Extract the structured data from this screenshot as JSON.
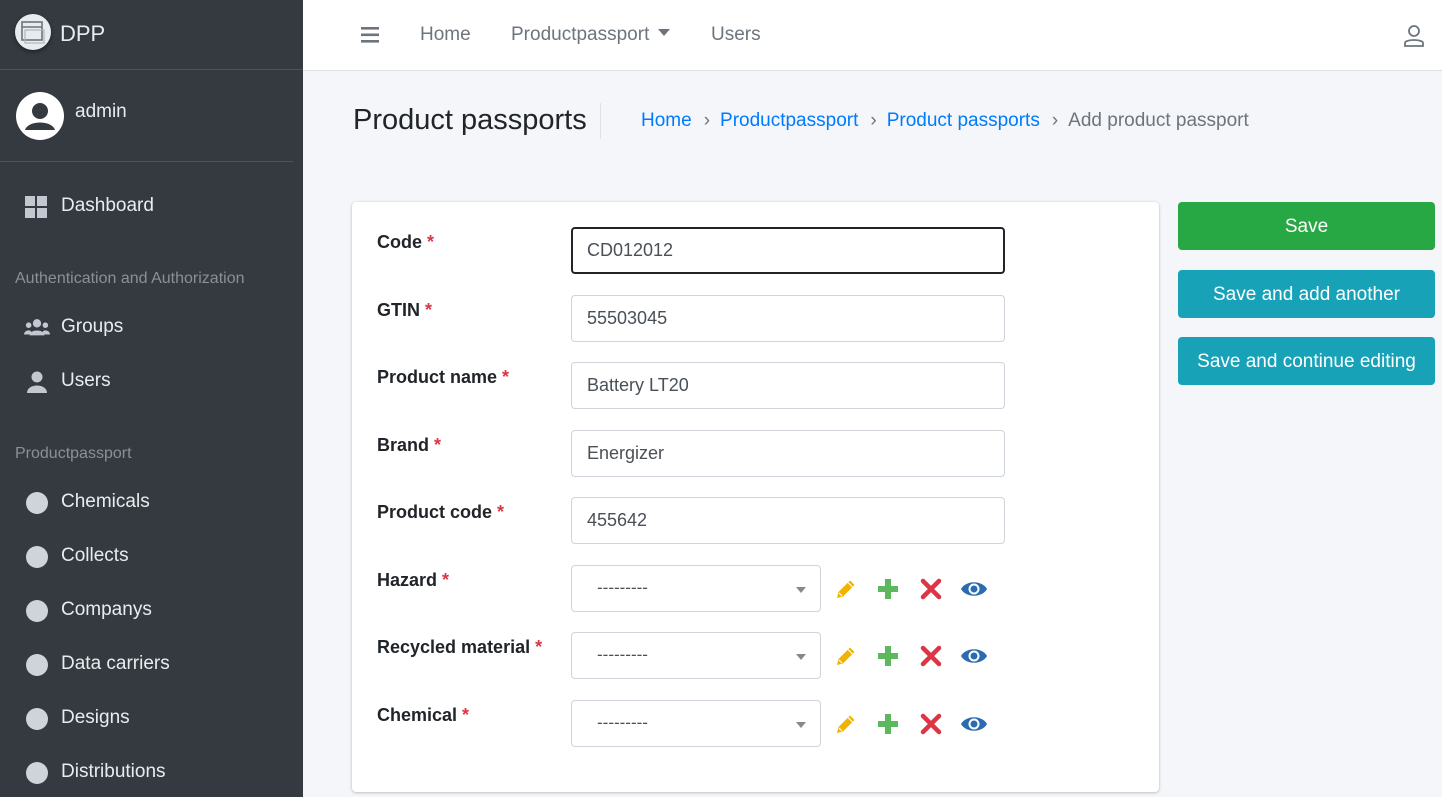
{
  "brand": {
    "name": "DPP"
  },
  "user": {
    "name": "admin"
  },
  "sidebar": {
    "dashboard": "Dashboard",
    "section_auth": "Authentication and Authorization",
    "auth_items": [
      "Groups",
      "Users"
    ],
    "section_pp": "Productpassport",
    "pp_items": [
      "Chemicals",
      "Collects",
      "Companys",
      "Data carriers",
      "Designs",
      "Distributions"
    ]
  },
  "topnav": {
    "home": "Home",
    "productpassport": "Productpassport",
    "users": "Users"
  },
  "page": {
    "title": "Product passports",
    "breadcrumb": [
      "Home",
      "Productpassport",
      "Product passports"
    ],
    "breadcrumb_active": "Add product passport",
    "breadcrumb_sep": "›"
  },
  "form": {
    "required_mark": "*",
    "fields": {
      "code": {
        "label": "Code",
        "value": "CD012012"
      },
      "gtin": {
        "label": "GTIN",
        "value": "55503045"
      },
      "product_name": {
        "label": "Product name",
        "value": "Battery LT20"
      },
      "brand": {
        "label": "Brand",
        "value": "Energizer"
      },
      "product_code": {
        "label": "Product code",
        "value": "455642"
      },
      "hazard": {
        "label": "Hazard",
        "value": "---------"
      },
      "recycled_material": {
        "label": "Recycled material",
        "value": "---------"
      },
      "chemical": {
        "label": "Chemical",
        "value": "---------"
      }
    }
  },
  "buttons": {
    "save": "Save",
    "save_add": "Save and add another",
    "save_continue": "Save and continue editing"
  },
  "colors": {
    "sidebar_bg": "#343a40",
    "success": "#28a745",
    "info": "#17a2b8",
    "link": "#007bff",
    "required": "#dc3545",
    "edit_icon": "#f0b400",
    "add_icon": "#5cb85c",
    "delete_icon": "#dc3545",
    "view_icon": "#2b6cb0"
  },
  "icons": {
    "brand_logo": "window-icon",
    "user_avatar": "user-circle-icon",
    "dashboard": "grid-icon",
    "groups": "users-icon",
    "users": "user-icon",
    "model": "circle-icon",
    "menu": "hamburger-icon",
    "profile": "user-outline-icon",
    "edit": "pencil-icon",
    "add": "plus-icon",
    "delete": "x-icon",
    "view": "eye-icon"
  }
}
